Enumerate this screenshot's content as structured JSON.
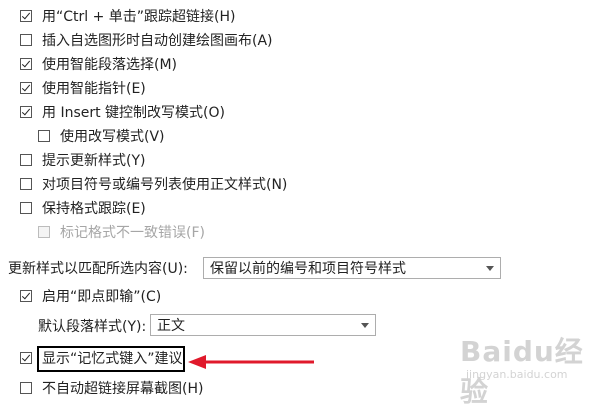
{
  "options": [
    {
      "key": "ctrl_click",
      "label": "用“Ctrl + 单击”跟踪超链接(H)",
      "checked": true
    },
    {
      "key": "insert_canvas",
      "label": "插入自选图形时自动创建绘图画布(A)",
      "checked": false
    },
    {
      "key": "smart_para",
      "label": "使用智能段落选择(M)",
      "checked": true
    },
    {
      "key": "smart_cursor",
      "label": "使用智能指针(E)",
      "checked": true
    },
    {
      "key": "insert_key",
      "label": "用 Insert 键控制改写模式(O)",
      "checked": true
    },
    {
      "key": "overtype",
      "label": "使用改写模式(V)",
      "checked": false
    },
    {
      "key": "prompt_update",
      "label": "提示更新样式(Y)",
      "checked": false
    },
    {
      "key": "normal_style_lists",
      "label": "对项目符号或编号列表使用正文样式(N)",
      "checked": false
    },
    {
      "key": "keep_format",
      "label": "保持格式跟踪(E)",
      "checked": false
    },
    {
      "key": "mark_inconsistency",
      "label": "标记格式不一致错误(F)",
      "checked": false,
      "disabled": true
    },
    {
      "key": "click_type",
      "label": "启用“即点即输”(C)",
      "checked": true
    },
    {
      "key": "autocomplete",
      "label": "显示“记忆式键入”建议",
      "checked": true
    },
    {
      "key": "no_autolink_screenshot",
      "label": "不自动超链接屏幕截图(H)",
      "checked": false
    }
  ],
  "update_style": {
    "label": "更新样式以匹配所选内容(U):",
    "value": "保留以前的编号和项目符号样式"
  },
  "default_para": {
    "label": "默认段落样式(Y):",
    "value": "正文"
  },
  "watermark": {
    "main": "Baidu经验",
    "sub": "jingyan.baidu.com"
  },
  "colors": {
    "arrow": "#e0192b",
    "highlight_border": "#000000"
  }
}
